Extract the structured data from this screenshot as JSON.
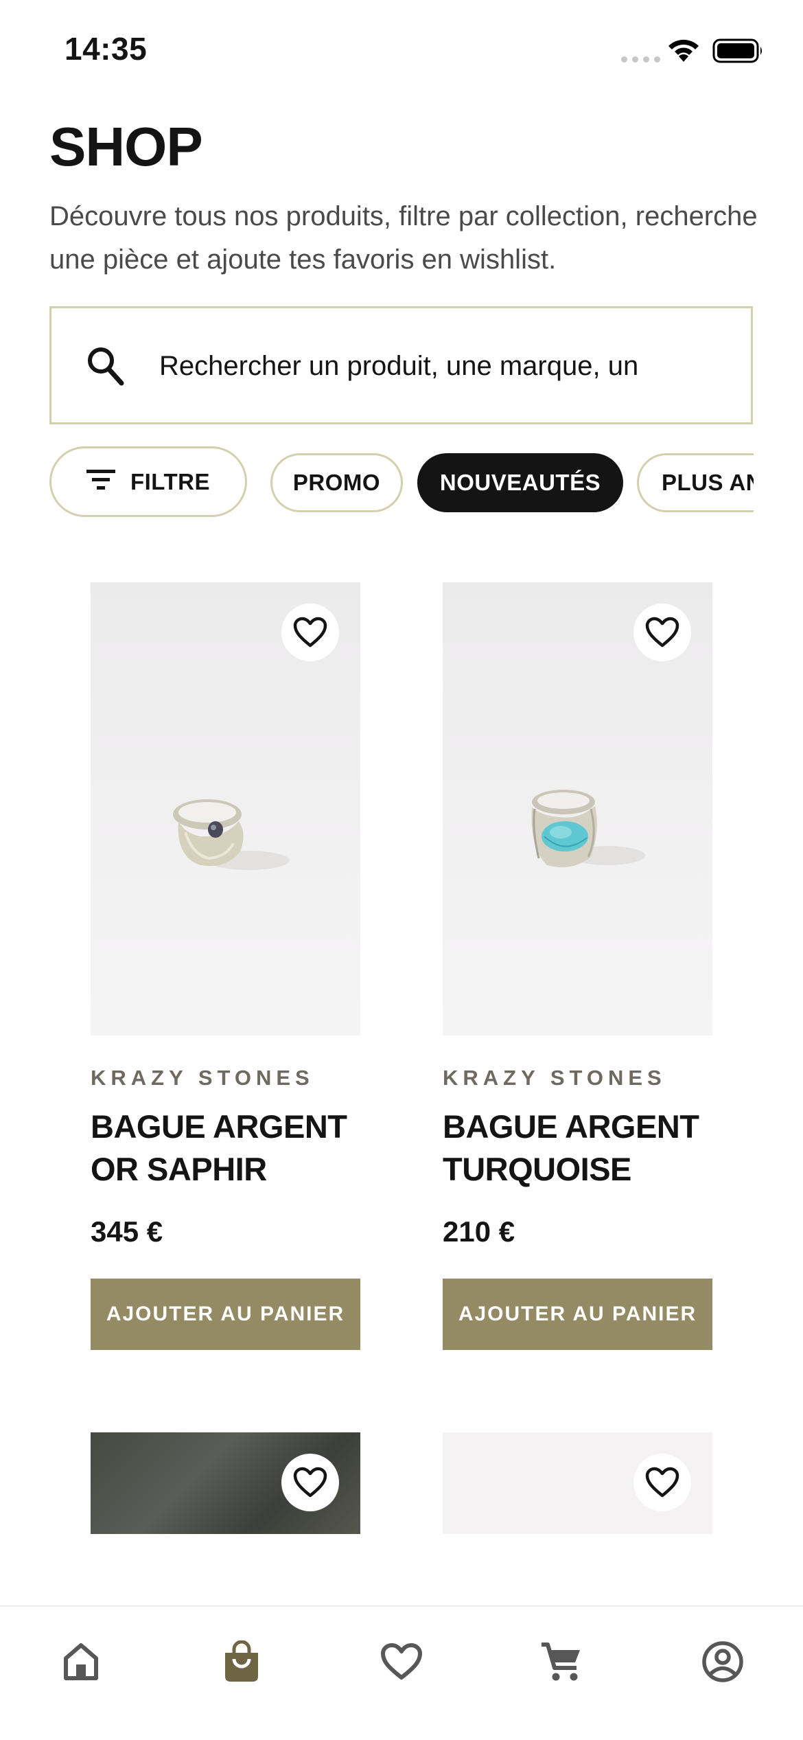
{
  "status_bar": {
    "time": "14:35"
  },
  "header": {
    "title": "SHOP",
    "subtitle": "Découvre tous nos produits, filtre par collection, recherche une pièce et ajoute tes favoris en wishlist."
  },
  "search": {
    "placeholder": "Rechercher un produit, une marque, un"
  },
  "chips": {
    "filter": "FILTRE",
    "items": [
      {
        "label": "PROMO",
        "active": false
      },
      {
        "label": "NOUVEAUTÉS",
        "active": true
      },
      {
        "label": "PLUS ANCIENS",
        "active": false
      }
    ]
  },
  "products": [
    {
      "brand": "KRAZY STONES",
      "name": "BAGUE ARGENT OR SAPHIR",
      "price": "345 €",
      "cta": "AJOUTER AU PANIER",
      "favorite": false
    },
    {
      "brand": "KRAZY STONES",
      "name": "BAGUE ARGENT TURQUOISE",
      "price": "210 €",
      "cta": "AJOUTER AU PANIER",
      "favorite": false
    }
  ],
  "nav": {
    "items": [
      {
        "icon": "home-icon",
        "active": false
      },
      {
        "icon": "shopping-bag-icon",
        "active": true
      },
      {
        "icon": "heart-icon",
        "active": false
      },
      {
        "icon": "cart-icon",
        "active": false
      },
      {
        "icon": "account-icon",
        "active": false
      }
    ]
  },
  "colors": {
    "accent": "#948a63",
    "border": "#d3d0ad",
    "active_chip": "#141414"
  }
}
